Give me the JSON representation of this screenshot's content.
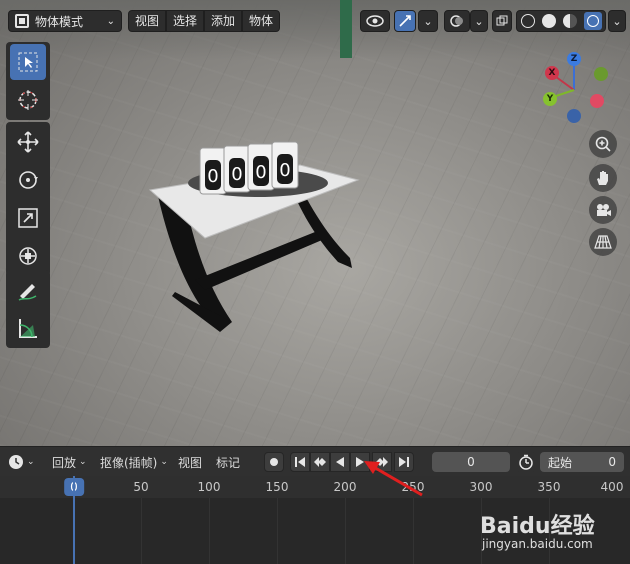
{
  "header": {
    "mode_label": "物体模式",
    "menus": [
      "视图",
      "选择",
      "添加",
      "物体"
    ]
  },
  "viewport": {
    "gizmo": {
      "z": "Z",
      "x": "X",
      "y": "Y"
    },
    "scene_digits": [
      "0",
      "0",
      "0",
      "0"
    ]
  },
  "timeline": {
    "playback": "回放",
    "keying": "抠像(插帧)",
    "view": "视图",
    "marker": "标记",
    "current_frame": "0",
    "start_label": "起始",
    "start_value": "0",
    "ruler_ticks": [
      "0",
      "50",
      "100",
      "150",
      "200",
      "250",
      "300",
      "350",
      "400"
    ]
  },
  "watermark": {
    "brand": "Baidu经验",
    "url": "jingyan.baidu.com"
  },
  "colors": {
    "accent": "#4772b3",
    "annotation": "#e01f1f"
  }
}
